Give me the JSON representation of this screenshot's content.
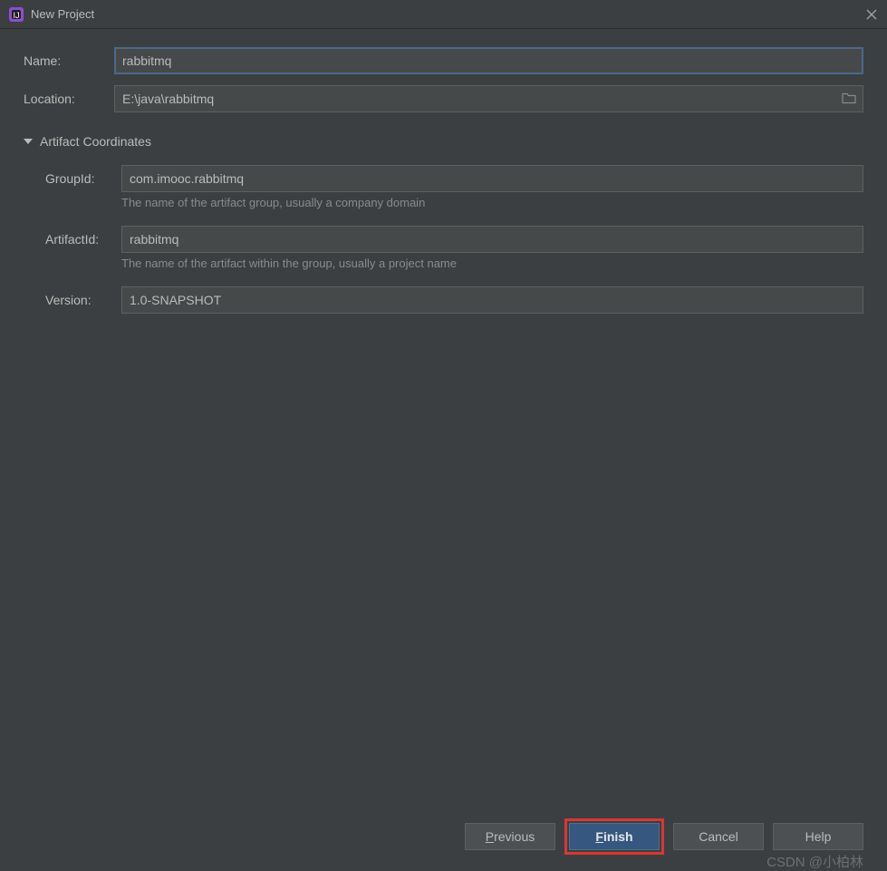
{
  "window": {
    "title": "New Project"
  },
  "form": {
    "name_label": "Name:",
    "name_value": "rabbitmq",
    "location_label": "Location:",
    "location_value": "E:\\java\\rabbitmq"
  },
  "artifact": {
    "section_title": "Artifact Coordinates",
    "group_id_label": "GroupId:",
    "group_id_value": "com.imooc.rabbitmq",
    "group_id_hint": "The name of the artifact group, usually a company domain",
    "artifact_id_label": "ArtifactId:",
    "artifact_id_value": "rabbitmq",
    "artifact_id_hint": "The name of the artifact within the group, usually a project name",
    "version_label": "Version:",
    "version_value": "1.0-SNAPSHOT"
  },
  "buttons": {
    "previous_mnemonic": "P",
    "previous_rest": "revious",
    "finish_mnemonic": "F",
    "finish_rest": "inish",
    "cancel": "Cancel",
    "help": "Help"
  },
  "watermark": "CSDN @小柏林"
}
